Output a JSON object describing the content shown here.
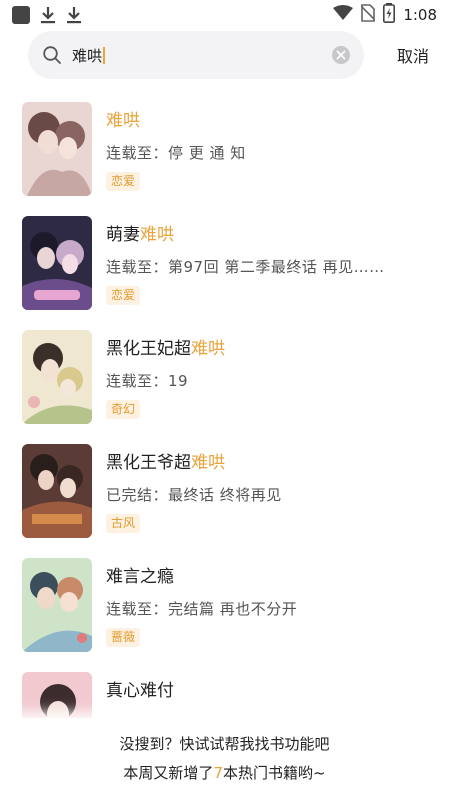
{
  "status_bar": {
    "time": "1:08",
    "icons": [
      "app-icon",
      "download-icon",
      "download-icon",
      "wifi-icon",
      "no-sim-icon",
      "battery-charging-icon"
    ]
  },
  "search": {
    "query": "难哄",
    "clear_icon": "clear-icon",
    "cancel_label": "取消"
  },
  "results": [
    {
      "title_prefix": "",
      "title_highlight": "难哄",
      "title_suffix": "",
      "status": "连载至：停 更 通 知",
      "tag": "恋爱"
    },
    {
      "title_prefix": "萌妻",
      "title_highlight": "难哄",
      "title_suffix": "",
      "status": "连载至：第97回 第二季最终话 再见……",
      "tag": "恋爱"
    },
    {
      "title_prefix": "黑化王妃超",
      "title_highlight": "难哄",
      "title_suffix": "",
      "status": "连载至：19",
      "tag": "奇幻"
    },
    {
      "title_prefix": "黑化王爷超",
      "title_highlight": "难哄",
      "title_suffix": "",
      "status": "已完结：最终话 终将再见",
      "tag": "古风"
    },
    {
      "title_prefix": "难言之瘾",
      "title_highlight": "",
      "title_suffix": "",
      "status": "连载至：完结篇 再也不分开",
      "tag": "蔷薇"
    },
    {
      "title_prefix": "真心难付",
      "title_highlight": "",
      "title_suffix": "",
      "status": "",
      "tag": ""
    }
  ],
  "bottom_prompt": {
    "line1": "没搜到？快试试帮我找书功能吧",
    "line2_prefix": "本周又新增了",
    "line2_number": "7",
    "line2_suffix": "本热门书籍哟~"
  },
  "colors": {
    "highlight": "#e8a33b",
    "tag_bg": "#fdf1e2",
    "search_bg": "#f3f3f5"
  }
}
